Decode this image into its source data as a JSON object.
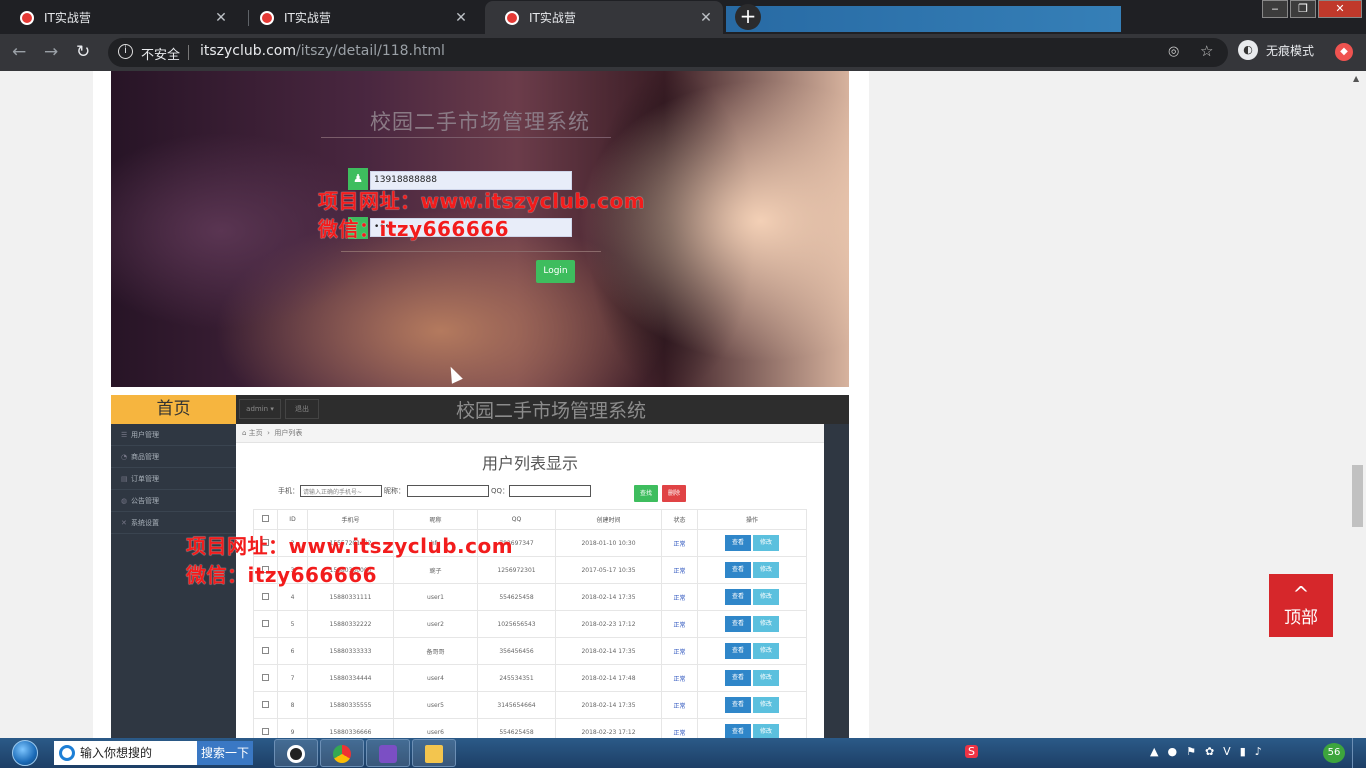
{
  "browser": {
    "tabs": [
      {
        "title": "IT实战营",
        "active": false
      },
      {
        "title": "IT实战营",
        "active": false
      },
      {
        "title": "IT实战营",
        "active": true
      }
    ],
    "security_label": "不安全",
    "url_host": "itszyclub.com",
    "url_path": "/itszy/detail/118.html",
    "incognito_label": "无痕模式",
    "colors": {
      "accent": "#d6272b",
      "green": "#3ebd5e"
    }
  },
  "login_shot": {
    "title": "校园二手市场管理系统",
    "username_value": "13918888888",
    "password_value": "•••",
    "login_button": "Login"
  },
  "watermark": {
    "line1": "项目网址：www.itszyclub.com",
    "line2": "微信：itzy666666"
  },
  "admin_shot": {
    "home_label": "首页",
    "admin_menu": "admin ▾",
    "logout_label": "退出",
    "title": "校园二手市场管理系统",
    "sidebar": [
      "用户管理",
      "商品管理",
      "订单管理",
      "公告管理",
      "系统设置"
    ],
    "breadcrumb": [
      "主页",
      "用户列表"
    ],
    "page_heading": "用户列表显示",
    "filter": {
      "phone_label": "手机：",
      "phone_placeholder": "请输入正确的手机号~",
      "nick_label": "昵称：",
      "qq_label": "QQ：",
      "search_button": "查找",
      "delete_button": "删除"
    },
    "columns": [
      "",
      "ID",
      "手机号",
      "昵称",
      "QQ",
      "创建时间",
      "状态",
      "操作"
    ],
    "rows": [
      {
        "id": "2",
        "phone": "15557201622",
        "nick": "hfy",
        "qq": "782697347",
        "created": "2018-01-10 10:30",
        "status": "正常"
      },
      {
        "id": "3",
        "phone": "15880330000",
        "nick": "豌子",
        "qq": "1256972301",
        "created": "2017-05-17 10:35",
        "status": "正常"
      },
      {
        "id": "4",
        "phone": "15880331111",
        "nick": "user1",
        "qq": "554625458",
        "created": "2018-02-14 17:35",
        "status": "正常"
      },
      {
        "id": "5",
        "phone": "15880332222",
        "nick": "user2",
        "qq": "1025656543",
        "created": "2018-02-23 17:12",
        "status": "正常"
      },
      {
        "id": "6",
        "phone": "15880333333",
        "nick": "备哥哥",
        "qq": "356456456",
        "created": "2018-02-14 17:35",
        "status": "正常"
      },
      {
        "id": "7",
        "phone": "15880334444",
        "nick": "user4",
        "qq": "245534351",
        "created": "2018-02-14 17:48",
        "status": "正常"
      },
      {
        "id": "8",
        "phone": "15880335555",
        "nick": "user5",
        "qq": "3145654664",
        "created": "2018-02-14 17:35",
        "status": "正常"
      },
      {
        "id": "9",
        "phone": "15880336666",
        "nick": "user6",
        "qq": "554625458",
        "created": "2018-02-23 17:12",
        "status": "正常"
      }
    ],
    "view_label": "查看",
    "edit_label": "修改"
  },
  "top_button": {
    "label": "顶部",
    "chevron": "^"
  },
  "taskbar": {
    "search_placeholder": "输入你想搜的",
    "search_button": "搜索一下",
    "battery_badge": "56"
  }
}
